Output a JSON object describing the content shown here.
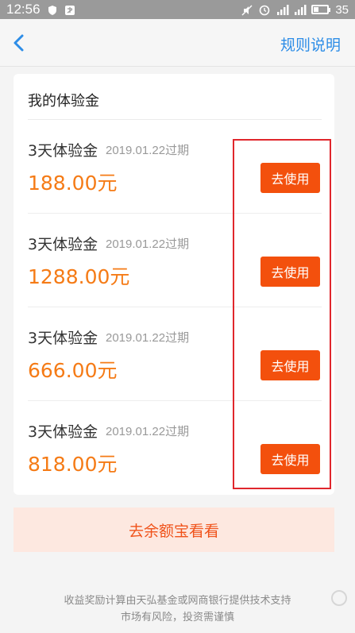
{
  "status_bar": {
    "time": "12:56",
    "battery": "35",
    "battery_level": 0.35
  },
  "header": {
    "rules_label": "规则说明"
  },
  "card": {
    "title": "我的体验金",
    "items": [
      {
        "name": "3天体验金",
        "expiry": "2019.01.22过期",
        "amount": "188.00元",
        "button": "去使用"
      },
      {
        "name": "3天体验金",
        "expiry": "2019.01.22过期",
        "amount": "1288.00元",
        "button": "去使用"
      },
      {
        "name": "3天体验金",
        "expiry": "2019.01.22过期",
        "amount": "666.00元",
        "button": "去使用"
      },
      {
        "name": "3天体验金",
        "expiry": "2019.01.22过期",
        "amount": "818.00元",
        "button": "去使用"
      }
    ]
  },
  "bottom_button": "去余额宝看看",
  "footer": {
    "line1": "收益奖励计算由天弘基金或网商银行提供技术支持",
    "line2": "市场有风险，投资需谨慎"
  },
  "colors": {
    "accent_blue": "#2d8de7",
    "amount_orange": "#f57b16",
    "button_red_orange": "#f3500d",
    "highlight_red": "#e0262c"
  }
}
